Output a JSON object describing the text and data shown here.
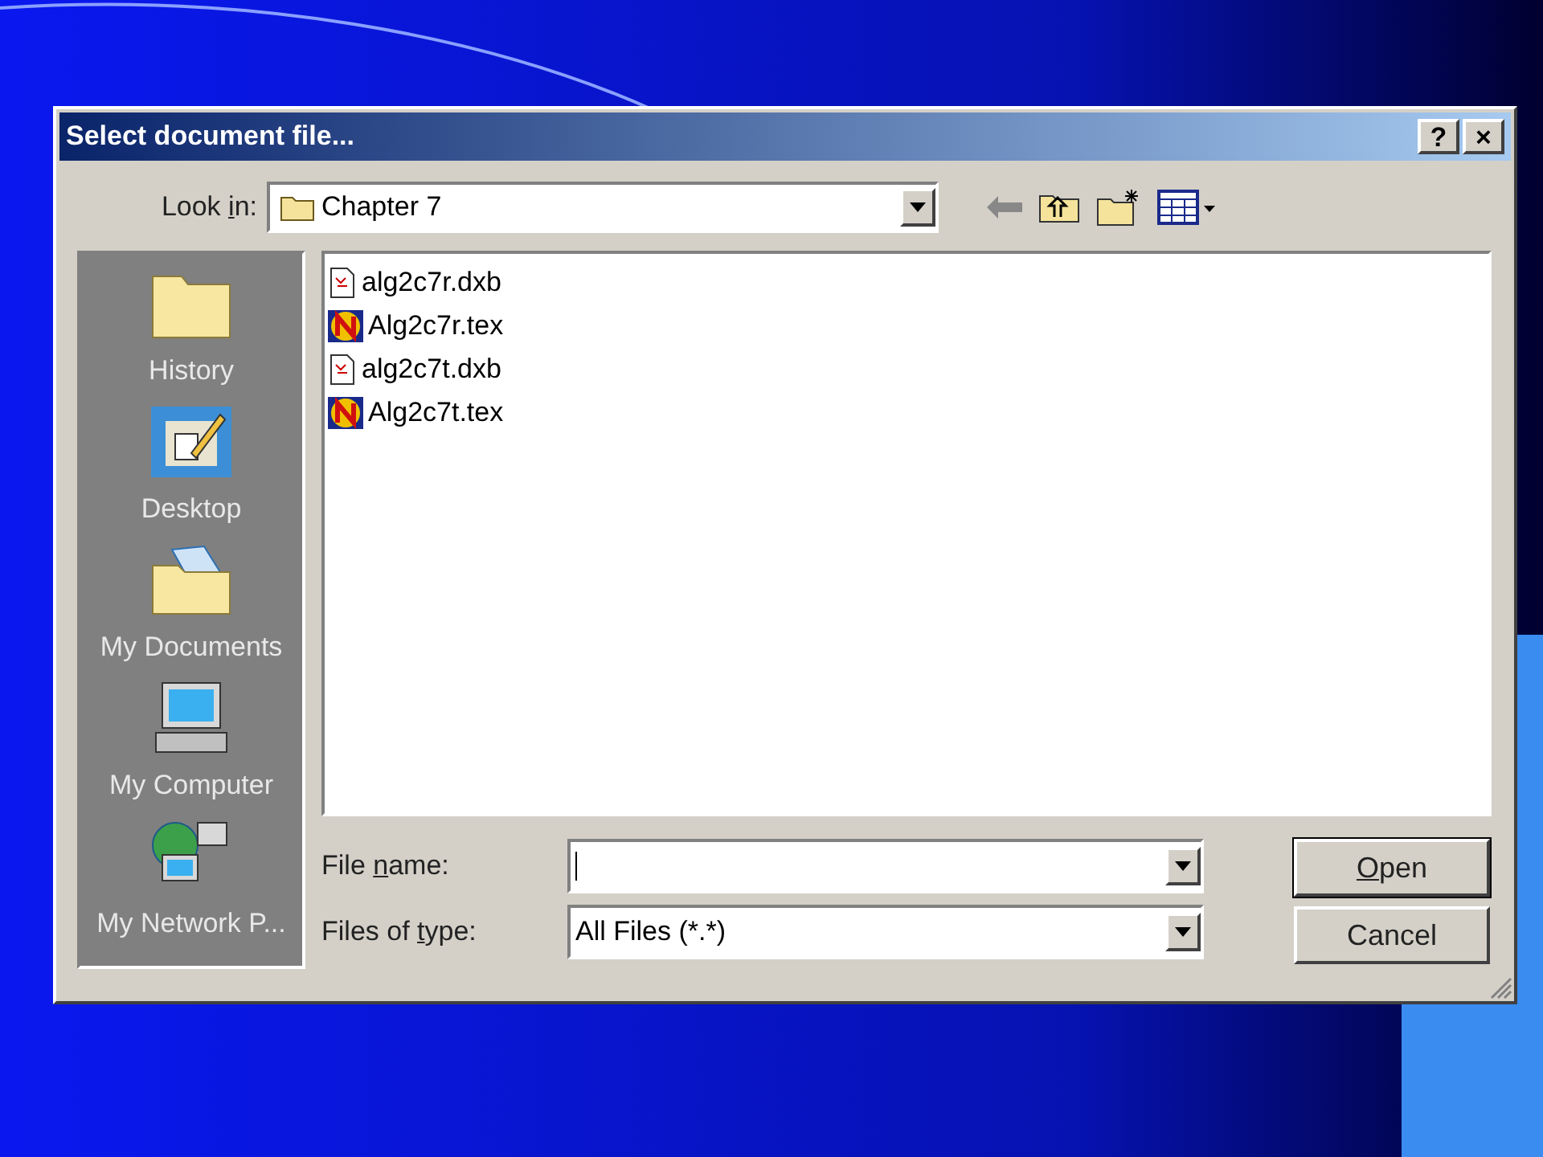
{
  "window": {
    "title": "Select document file...",
    "title_buttons": [
      "?",
      "×"
    ]
  },
  "look_in": {
    "label": {
      "pre": "Look ",
      "key": "i",
      "post": "n:"
    },
    "value": "Chapter 7"
  },
  "places": [
    {
      "label": "History",
      "kind": "history"
    },
    {
      "label": "Desktop",
      "kind": "desktop"
    },
    {
      "label": "My Documents",
      "kind": "documents"
    },
    {
      "label": "My Computer",
      "kind": "computer"
    },
    {
      "label": "My Network P...",
      "kind": "network"
    }
  ],
  "files": [
    {
      "name": "alg2c7r.dxb",
      "kind": "dxb"
    },
    {
      "name": "Alg2c7r.tex",
      "kind": "tex"
    },
    {
      "name": "alg2c7t.dxb",
      "kind": "dxb"
    },
    {
      "name": "Alg2c7t.tex",
      "kind": "tex"
    }
  ],
  "file_name": {
    "label": {
      "pre": "File ",
      "key": "n",
      "post": "ame:"
    }
  },
  "file_type": {
    "label": {
      "pre": "Files of ",
      "key": "t",
      "post": "ype:"
    },
    "value": "All Files (*.*)"
  },
  "buttons": [
    {
      "label": {
        "key": "O",
        "post": "pen"
      },
      "default": true
    },
    {
      "label": {
        "pre": "Cancel"
      },
      "default": false
    }
  ]
}
